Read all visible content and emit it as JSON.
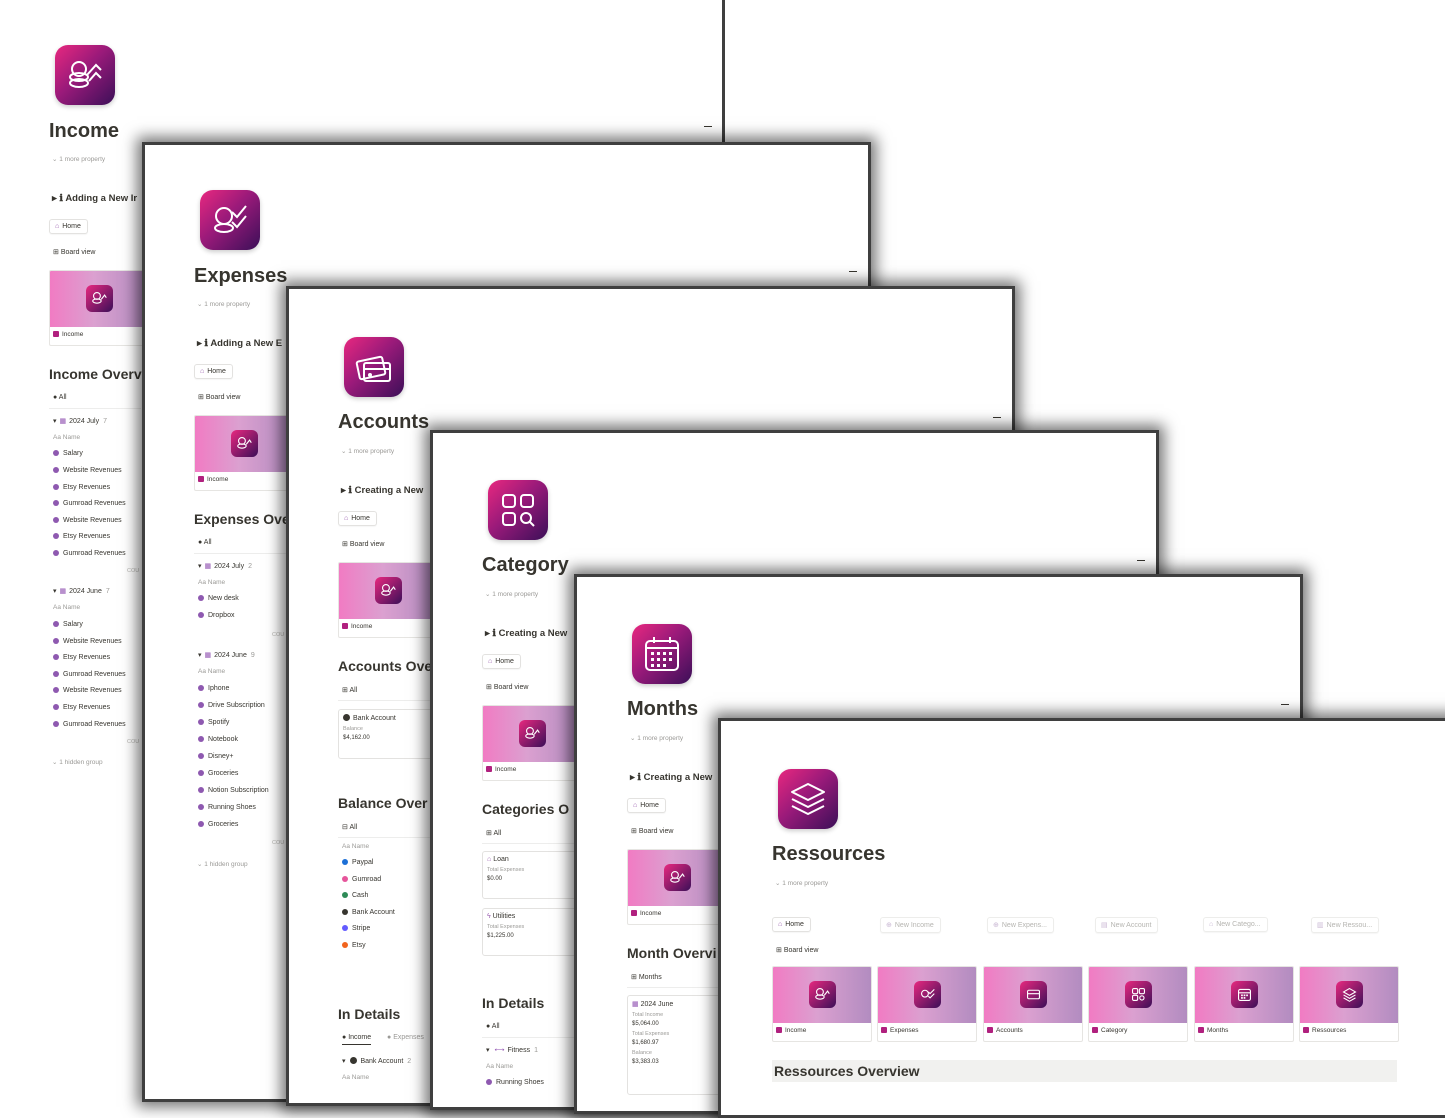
{
  "windows": {
    "income": {
      "title": "Income",
      "more": "1 more property",
      "toggle": "Adding a New Ir",
      "home": "Home",
      "board_view": "Board view",
      "card": "Income",
      "overview": "Income Overv",
      "filter_all": "All",
      "col_name": "Name",
      "groups": [
        {
          "label": "2024 July",
          "count": "7",
          "rows": [
            "Salary",
            "Website Revenues",
            "Etsy Revenues",
            "Gumroad Revenues",
            "Website Revenues",
            "Etsy Revenues",
            "Gumroad Revenues"
          ]
        },
        {
          "label": "2024 June",
          "count": "7",
          "rows": [
            "Salary",
            "Website Revenues",
            "Etsy Revenues",
            "Gumroad Revenues",
            "Website Revenues",
            "Etsy Revenues",
            "Gumroad Revenues"
          ]
        }
      ],
      "count_cap": "COU",
      "hidden": "1 hidden group"
    },
    "expenses": {
      "title": "Expenses",
      "more": "1 more property",
      "toggle": "Adding a New E",
      "home": "Home",
      "board_view": "Board view",
      "card": "Income",
      "overview": "Expenses Ove",
      "filter_all": "All",
      "col_name": "Name",
      "groups": [
        {
          "label": "2024 July",
          "count": "2",
          "rows": [
            "New desk",
            "Dropbox"
          ]
        },
        {
          "label": "2024 June",
          "count": "9",
          "rows": [
            "Iphone",
            "Drive Subscription",
            "Spotify",
            "Notebook",
            "Disney+",
            "Groceries",
            "Notion Subscription",
            "Running Shoes",
            "Groceries"
          ]
        }
      ],
      "count_cap": "COU",
      "hidden": "1 hidden group"
    },
    "accounts": {
      "title": "Accounts",
      "more": "1 more property",
      "toggle": "Creating a New",
      "home": "Home",
      "board_view": "Board view",
      "card": "Income",
      "overview": "Accounts Ove",
      "filter_all": "All",
      "account_card": {
        "name": "Bank Account",
        "label": "Balance",
        "value": "$4,162.00"
      },
      "balance_overview": "Balance Over",
      "balance_all": "All",
      "col_name": "Name",
      "balance_rows": [
        {
          "name": "Paypal",
          "color": "#1c6fd6"
        },
        {
          "name": "Gumroad",
          "color": "#e6559b"
        },
        {
          "name": "Cash",
          "color": "#2e8b57"
        },
        {
          "name": "Bank Account",
          "color": "#37352f"
        },
        {
          "name": "Stripe",
          "color": "#635bff"
        },
        {
          "name": "Etsy",
          "color": "#f1641e"
        }
      ],
      "in_details": "In Details",
      "tabs": [
        "Income",
        "Expenses"
      ],
      "detail_group": {
        "label": "Bank Account",
        "count": "2"
      },
      "detail_col": "Name"
    },
    "category": {
      "title": "Category",
      "more": "1 more property",
      "toggle": "Creating a New",
      "home": "Home",
      "board_view": "Board view",
      "card": "Income",
      "overview": "Categories O",
      "filter_all": "All",
      "cards": [
        {
          "name": "Loan",
          "label": "Total Expenses",
          "value": "$0.00"
        },
        {
          "name": "Utilities",
          "label": "Total Expenses",
          "value": "$1,225.00"
        }
      ],
      "in_details": "In Details",
      "details_all": "All",
      "detail_group": {
        "label": "Fitness",
        "count": "1"
      },
      "detail_col": "Name",
      "detail_row": "Running Shoes"
    },
    "months": {
      "title": "Months",
      "more": "1 more property",
      "toggle": "Creating a New",
      "home": "Home",
      "board_view": "Board view",
      "card": "Income",
      "overview": "Month Overvi",
      "view": "Months",
      "month_card": {
        "name": "2024 June",
        "l1": "Total Income",
        "v1": "$5,064.00",
        "l2": "Total Expenses",
        "v2": "$1,680.97",
        "l3": "Balance",
        "v3": "$3,383.03"
      }
    },
    "ressources": {
      "title": "Ressources",
      "more": "1 more property",
      "buttons": [
        "Home",
        "New Income",
        "New Expens...",
        "New Account",
        "New Catego...",
        "New Ressou..."
      ],
      "board_view": "Board view",
      "cards": [
        "Income",
        "Expenses",
        "Accounts",
        "Category",
        "Months",
        "Ressources"
      ],
      "overview": "Ressources Overview"
    }
  },
  "colors": {
    "accent": "#b0207e",
    "icon_dark": "#3b0f58",
    "icon_pink": "#e8287f"
  }
}
